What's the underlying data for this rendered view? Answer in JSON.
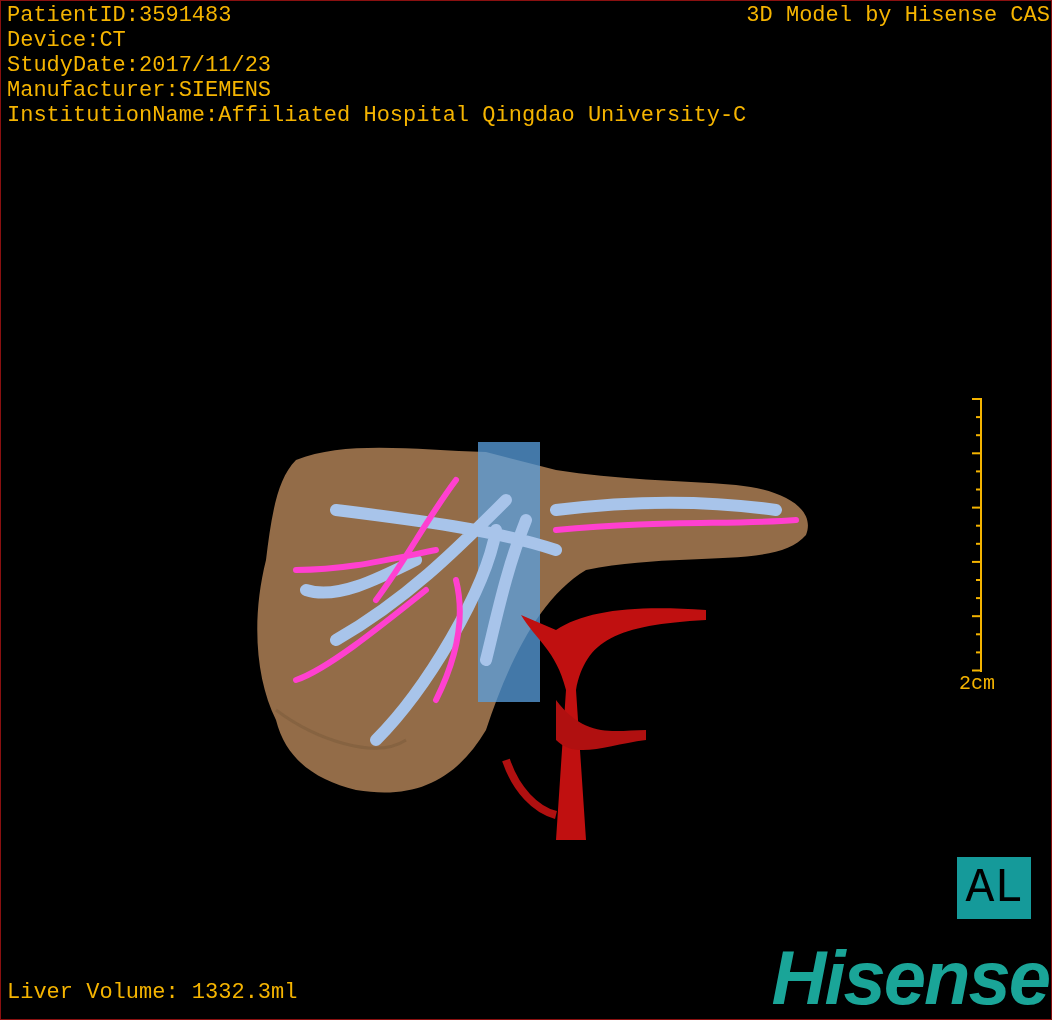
{
  "info_lines": [
    "PatientID:3591483",
    "Device:CT",
    "StudyDate:2017/11/23",
    "Manufacturer:SIEMENS",
    "InstitutionName:Affiliated Hospital Qingdao University-C"
  ],
  "title": "3D Model by Hisense CAS",
  "scale_bar": {
    "label": "2cm"
  },
  "liver_volume": "Liver Volume: 1332.3ml",
  "orientation": "AL",
  "logo": "Hisense"
}
